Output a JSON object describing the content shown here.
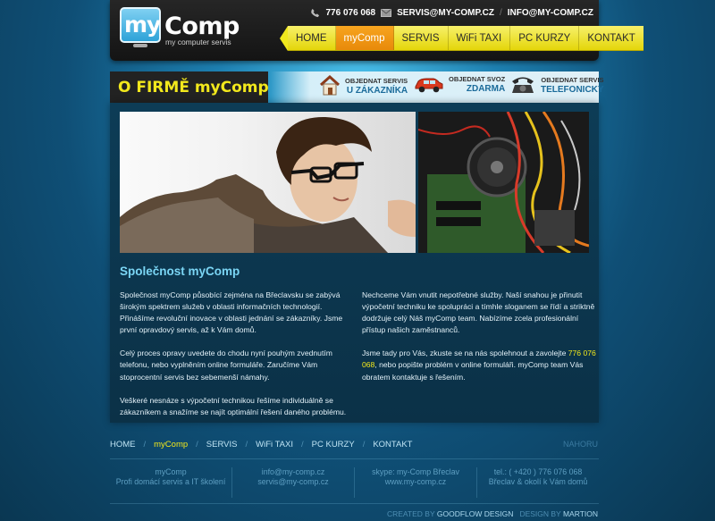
{
  "header": {
    "logo_box_text": "my",
    "logo_word": "Comp",
    "logo_sub": "my computer servis",
    "phone": "776 076 068",
    "email_servis": "SERVIS@MY-COMP.CZ",
    "separator": "/",
    "email_info": "INFO@MY-COMP.CZ"
  },
  "nav": {
    "items": [
      {
        "label": "HOME"
      },
      {
        "label": "myComp"
      },
      {
        "label": "SERVIS"
      },
      {
        "label": "WiFi TAXI"
      },
      {
        "label": "PC KURZY"
      },
      {
        "label": "KONTAKT"
      }
    ],
    "active_index": 1
  },
  "subhead": {
    "title": "O FIRMĚ myComp",
    "orders": [
      {
        "line1": "OBJEDNAT SERVIS",
        "line2": "U ZÁKAZNÍKA",
        "icon": "house-icon"
      },
      {
        "line1": "OBJEDNAT SVOZ",
        "line2": "ZDARMA",
        "icon": "car-icon"
      },
      {
        "line1": "OBJEDNAT SERVIS",
        "line2": "TELEFONICKY",
        "icon": "telephone-icon"
      }
    ]
  },
  "main": {
    "section_title": "Společnost myComp",
    "left": [
      "Společnost myComp působící zejména na Břeclavsku se zabývá širokým spektrem služeb v oblasti informačních technologií. Přinášíme revoluční inovace v oblasti jednání se zákazníky. Jsme první opravdový servis, až k Vám domů.",
      "Celý proces opravy uvedete do chodu nyní pouhým zvednutím telefonu, nebo vyplněním online formuláře. Zaručíme Vám stoprocentní servis bez sebemenší námahy.",
      "Veškeré nesnáze s výpočetní technikou řešíme individuálně se zákazníkem a snažíme se najít optimální řešení daného problému."
    ],
    "right": {
      "p1": "Nechceme Vám vnutit nepotřebné služby. Naší snahou je přinutit výpočetní techniku ke spolupráci a tímhle sloganem se řídí a striktně dodržuje celý Náš myComp team. Nabízíme zcela profesionální přístup našich zaměstnanců.",
      "p2_before": "Jsme tady pro Vás, zkuste se na nás spolehnout a zavolejte ",
      "p2_phone": "776 076 068",
      "p2_after": ", nebo popište problém v online formuláři. myComp team Vás obratem kontaktuje s řešením."
    }
  },
  "footer": {
    "nav": [
      "HOME",
      "myComp",
      "SERVIS",
      "WiFi TAXI",
      "PC KURZY",
      "KONTAKT"
    ],
    "nav_active_index": 1,
    "nav_separator": "/",
    "top_link": "NAHORU",
    "cols": [
      {
        "l1": "myComp",
        "l2": "Profi domácí servis a IT školení"
      },
      {
        "l1": "info@my-comp.cz",
        "l2": "servis@my-comp.cz"
      },
      {
        "l1": "skype: my-Comp Břeclav",
        "l2": "www.my-comp.cz"
      },
      {
        "l1": "tel.: ( +420 ) 776 076 068",
        "l2": "Břeclav & okolí k Vám domů"
      }
    ],
    "credits_created_label": "CREATED BY",
    "credits_created_name": "GOODFLOW DESIGN",
    "credits_design_label": "DESIGN BY",
    "credits_design_name": "MARTION"
  },
  "colors": {
    "accent_yellow": "#f2e81c",
    "active_orange": "#f29a17",
    "link_blue": "#7bd6f5",
    "header_dark": "#1c1c1c"
  }
}
